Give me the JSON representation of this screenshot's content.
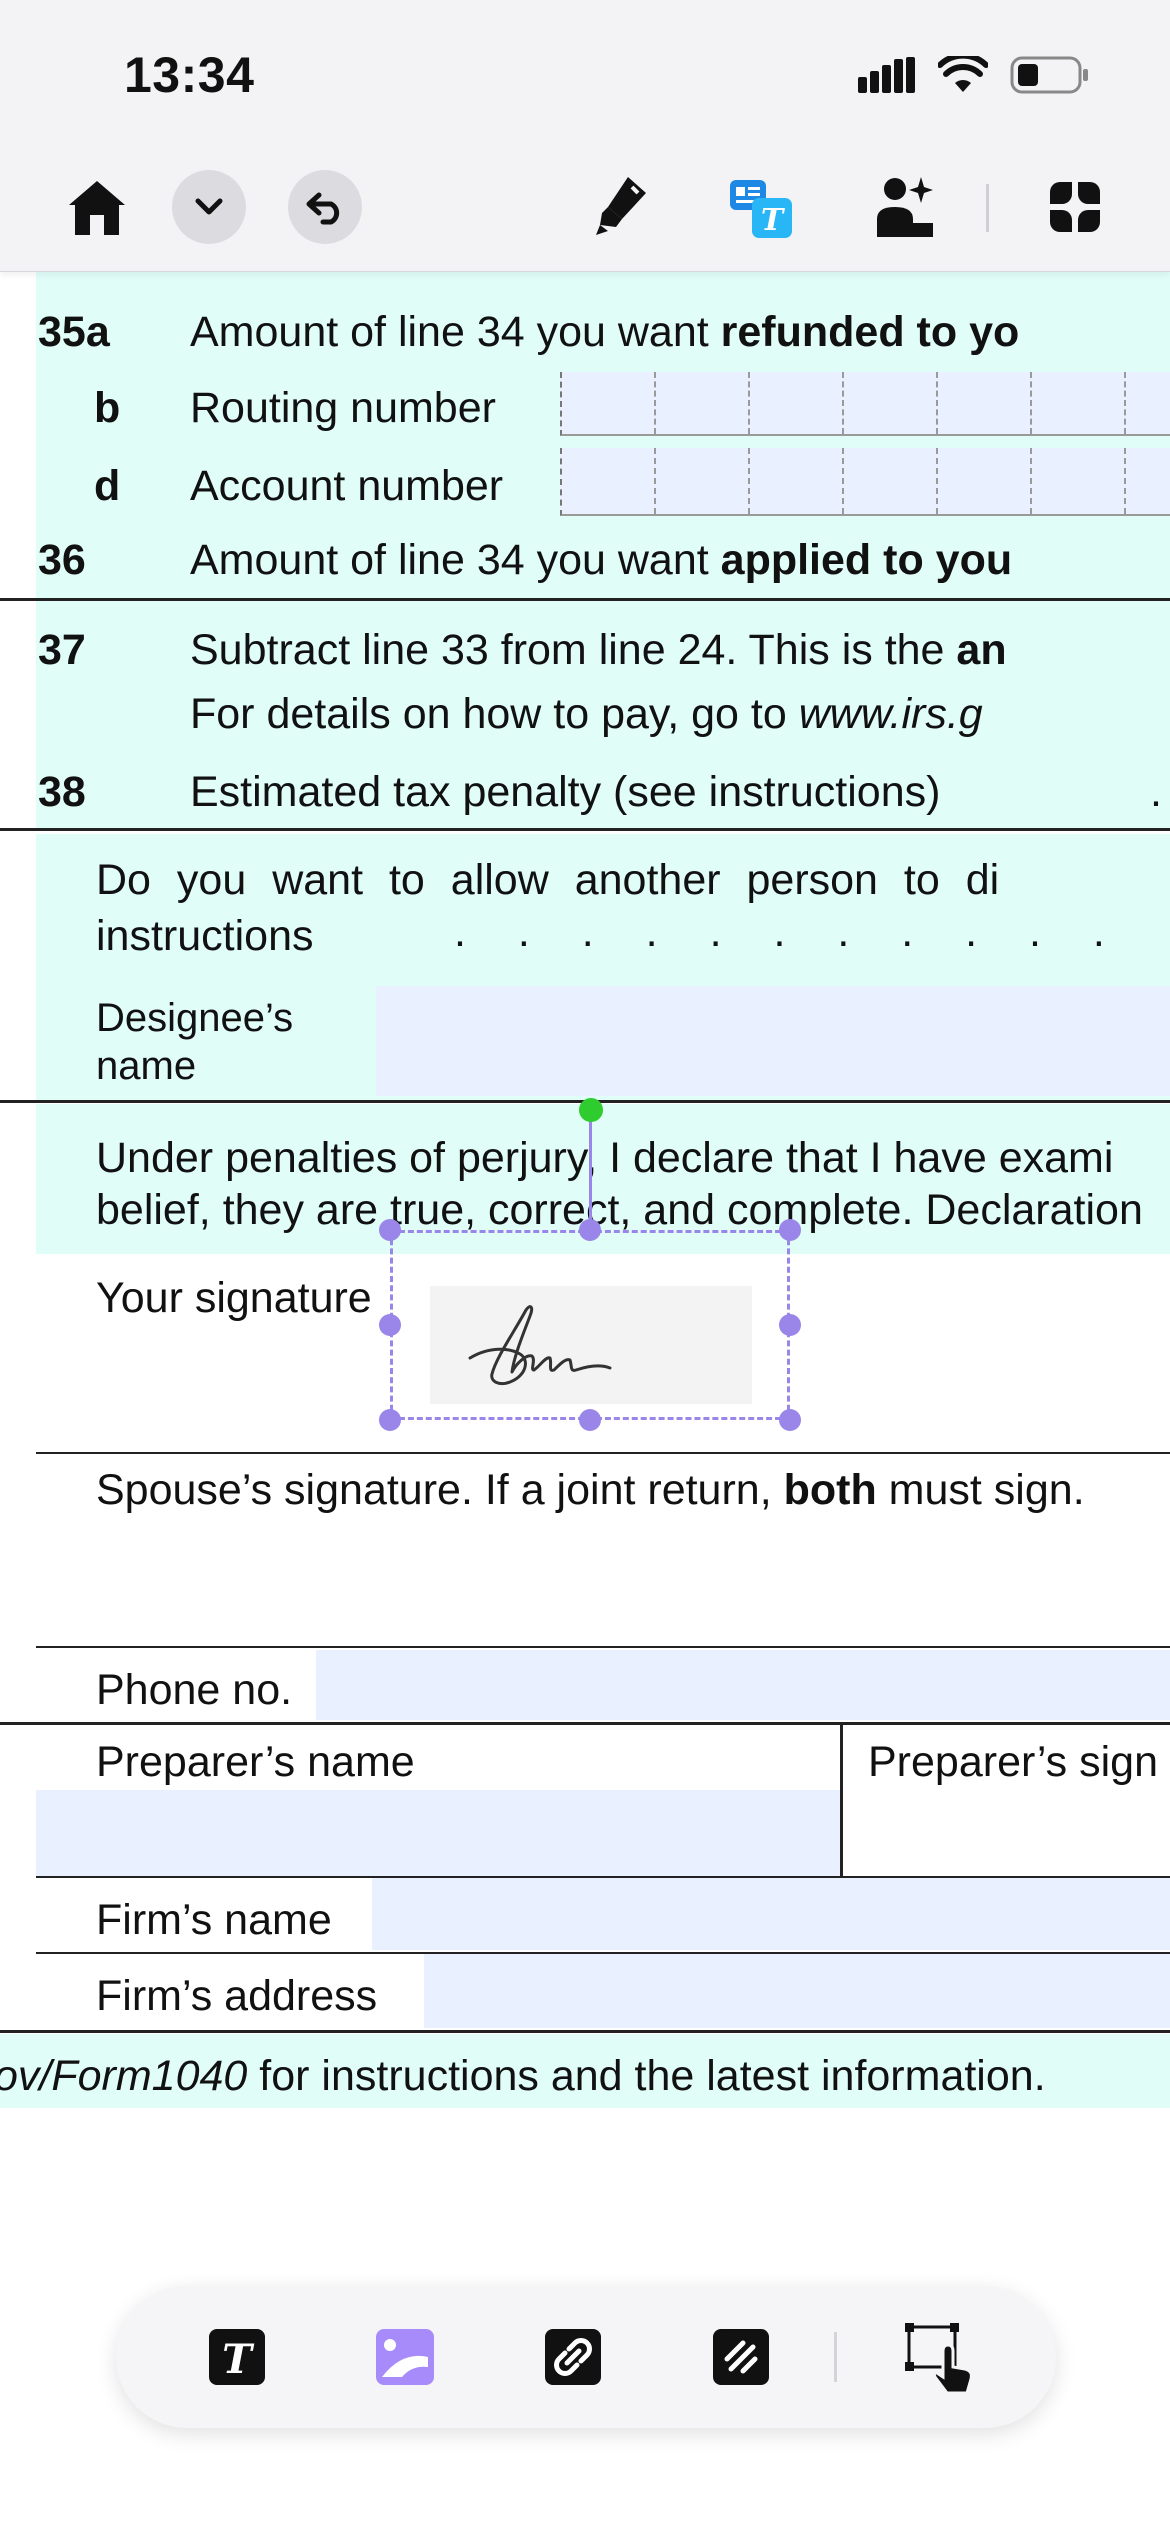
{
  "status_bar": {
    "time": "13:34"
  },
  "toolbar": {
    "home_icon": "home-icon",
    "dropdown_icon": "chevron-down-icon",
    "undo_icon": "undo-icon",
    "highlighter_icon": "highlighter-icon",
    "translate_icon": "translate-icon",
    "ai_photo_icon": "ai-image-icon",
    "apps_icon": "apps-grid-icon"
  },
  "form": {
    "line35a": {
      "num": "35a",
      "text_pre": "Amount of line 34 you want ",
      "text_bold": "refunded to yo"
    },
    "line35b": {
      "num": "b",
      "label": "Routing number"
    },
    "line35d": {
      "num": "d",
      "label": "Account number"
    },
    "line36": {
      "num": "36",
      "text_pre": "Amount of line 34 you want ",
      "text_bold": "applied to you"
    },
    "line37": {
      "num": "37",
      "text_pre": "Subtract line 33 from line 24. This is the ",
      "text_bold": "an",
      "line2_pre": "For details on how to pay, go to ",
      "line2_link": "www.irs.g"
    },
    "line38": {
      "num": "38",
      "text": "Estimated tax penalty (see instructions)",
      "dots": "."
    },
    "third_party": {
      "line1": "Do you want to allow another person to di",
      "line2": "instructions",
      "dots": ". . . . . . . . . . .",
      "designee_label_1": "Designee’s",
      "designee_label_2": "name"
    },
    "sign_here": {
      "declaration_1": "Under penalties of perjury, I declare that I have exami",
      "declaration_2": "belief, they are true, correct, and complete. Declaration",
      "your_signature": "Your signature",
      "spouse_pre": "Spouse’s signature. If a joint return, ",
      "spouse_bold": "both",
      "spouse_post": " must sign.",
      "phone": "Phone no."
    },
    "preparer": {
      "name": "Preparer’s name",
      "signature": "Preparer’s sign",
      "firm_name": "Firm’s name",
      "firm_address": "Firm’s address"
    },
    "footer": {
      "link": "ov/Form1040",
      "text": " for instructions and the latest information."
    }
  },
  "bottom_toolbar": {
    "text_tool": "text-tool-icon",
    "image_tool": "image-tool-icon",
    "link_tool": "link-tool-icon",
    "draw_tool": "signature-tool-icon",
    "select_tool": "select-tap-icon"
  },
  "colors": {
    "band": "#e0fdf8",
    "field": "#e9f0ff",
    "selection": "#9a86e8",
    "rotate_handle": "#2ecc2e",
    "accent_blue": "#1e88e5"
  }
}
